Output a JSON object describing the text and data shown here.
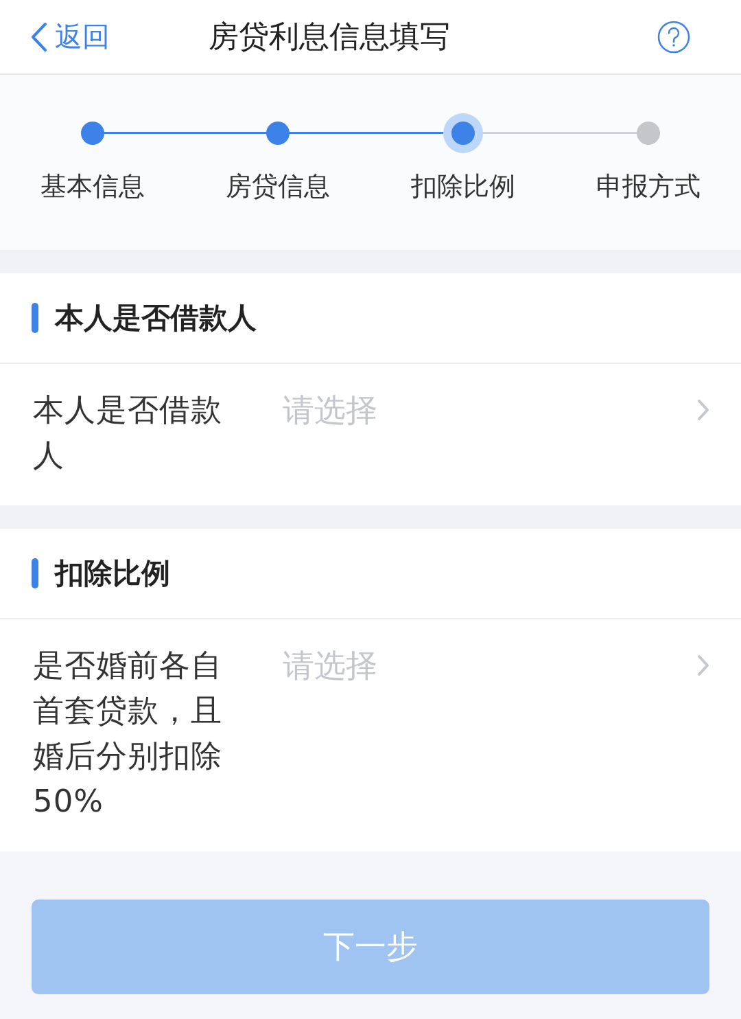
{
  "nav": {
    "back": "返回",
    "title": "房贷利息信息填写"
  },
  "steps": [
    {
      "label": "基本信息",
      "completed": true,
      "selected": false
    },
    {
      "label": "房贷信息",
      "completed": true,
      "selected": false
    },
    {
      "label": "扣除比例",
      "completed": false,
      "selected": true
    },
    {
      "label": "申报方式",
      "completed": false,
      "selected": false
    }
  ],
  "sections": [
    {
      "title": "本人是否借款人",
      "fields": [
        {
          "label": "本人是否借款人",
          "placeholder": "请选择"
        }
      ]
    },
    {
      "title": "扣除比例",
      "fields": [
        {
          "label": "是否婚前各自首套贷款，且婚后分别扣除50%",
          "placeholder": "请选择"
        }
      ]
    }
  ],
  "next_button": {
    "label": "下一步",
    "disabled": true
  }
}
